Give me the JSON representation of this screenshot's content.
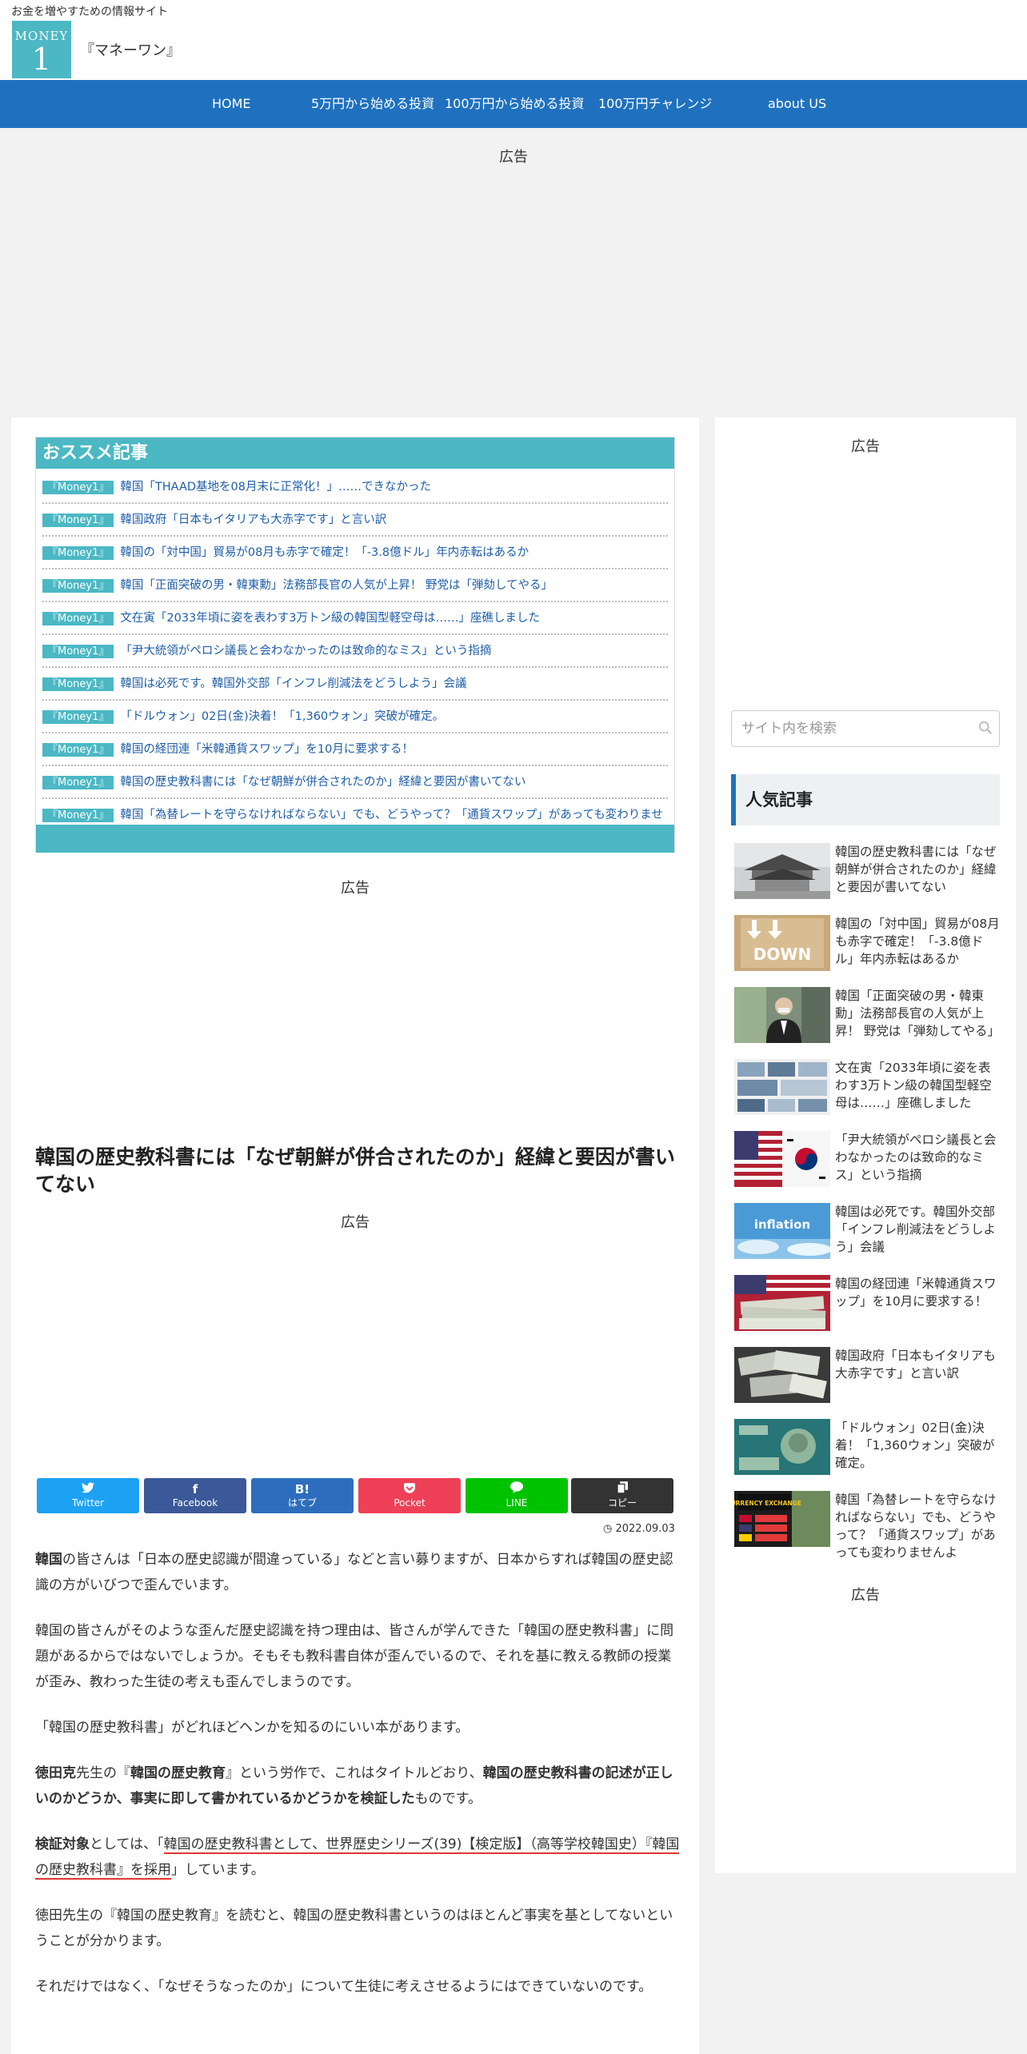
{
  "header": {
    "tagline": "お金を増やすための情報サイト",
    "logo_top": "MONEY",
    "logo_num": "1",
    "site_name": "『マネーワン』"
  },
  "nav": {
    "items": [
      "HOME",
      "5万円から始める投資",
      "100万円から始める投資",
      "100万円チャレンジ",
      "about US"
    ]
  },
  "ads": {
    "label": "広告"
  },
  "recommend": {
    "title": "おススメ記事",
    "tag": "『Money1』",
    "items": [
      "韓国「THAAD基地を08月末に正常化！」……できなかった",
      "韓国政府「日本もイタリアも大赤字です」と言い訳",
      "韓国の「対中国」貿易が08月も赤字で確定！「-3.8億ドル」年内赤転はあるか",
      "韓国「正面突破の男・韓東勳」法務部長官の人気が上昇！ 野党は「弾劾してやる」",
      "文在寅「2033年頃に姿を表わす3万トン級の韓国型軽空母は……」座礁しました",
      "「尹大統領がペロシ議長と会わなかったのは致命的なミス」という指摘",
      "韓国は必死です。韓国外交部「インフレ削減法をどうしよう」会議",
      "「ドルウォン」02日(金)決着！「1,360ウォン」突破が確定。",
      "韓国の経団連「米韓通貨スワップ」を10月に要求する！",
      "韓国の歴史教科書には「なぜ朝鮮が併合されたのか」経緯と要因が書いてない",
      "韓国「為替レートを守らなければならない」でも、どうやって？「通貨スワップ」があっても変わりませんよ"
    ]
  },
  "article": {
    "title": "韓国の歴史教科書には「なぜ朝鮮が併合されたのか」経緯と要因が書いてない",
    "date": "2022.09.03",
    "p1_bold": "韓国",
    "p1_rest": "の皆さんは「日本の歴史認識が間違っている」などと言い募りますが、日本からすれば韓国の歴史認識の方がいびつで歪んでいます。",
    "p2": "韓国の皆さんがそのような歪んだ歴史認識を持つ理由は、皆さんが学んできた「韓国の歴史教科書」に問題があるからではないでしょうか。そもそも教科書自体が歪んでいるので、それを基に教える教師の授業が歪み、教わった生徒の考えも歪んでしまうのです。",
    "p3": "「韓国の歴史教科書」がどれほどヘンかを知るのにいい本があります。",
    "p4_a": "徳田克",
    "p4_b": "先生の『",
    "p4_c": "韓国の歴史教育",
    "p4_d": "』という労作で、これはタイトルどおり、",
    "p4_e": "韓国の歴史教科書の記述が正しいのかどうか、事実に即して書かれているかどうかを検証した",
    "p4_f": "ものです。",
    "p5_a": "検証対象",
    "p5_b": "としては、「",
    "p5_link": "韓国の歴史教科書として、世界歴史シリーズ(39)【検定版】（高等学校韓国史）『韓国の歴史教科書』を採用",
    "p5_c": "」しています。",
    "p6": "徳田先生の『韓国の歴史教育』を読むと、韓国の歴史教科書というのはほとんど事実を基としてないということが分かります。",
    "p7": "それだけではなく、「なぜそうなったのか」について生徒に考えさせるようにはできていないのです。"
  },
  "share": {
    "buttons": [
      {
        "icon": "🐦",
        "label": "Twitter",
        "color": "#1da1f2"
      },
      {
        "icon": "f",
        "label": "Facebook",
        "color": "#3b5998"
      },
      {
        "icon": "B!",
        "label": "はてブ",
        "color": "#2c6ebd"
      },
      {
        "icon": "◉",
        "label": "Pocket",
        "color": "#ee4056"
      },
      {
        "icon": "●",
        "label": "LINE",
        "color": "#00c300"
      },
      {
        "icon": "⧉",
        "label": "コピー",
        "color": "#333333"
      }
    ]
  },
  "sidebar": {
    "search_placeholder": "サイト内を検索",
    "popular_title": "人気記事",
    "popular": [
      "韓国の歴史教科書には「なぜ朝鮮が併合されたのか」経緯と要因が書いてない",
      "韓国の「対中国」貿易が08月も赤字で確定！「-3.8億ドル」年内赤転はあるか",
      "韓国「正面突破の男・韓東勳」法務部長官の人気が上昇！ 野党は「弾劾してやる」",
      "文在寅「2033年頃に姿を表わす3万トン級の韓国型軽空母は……」座礁しました",
      "「尹大統領がペロシ議長と会わなかったのは致命的なミス」という指摘",
      "韓国は必死です。韓国外交部「インフレ削減法をどうしよう」会議",
      "韓国の経団連「米韓通貨スワップ」を10月に要求する！",
      "韓国政府「日本もイタリアも大赤字です」と言い訳",
      "「ドルウォン」02日(金)決着！「1,360ウォン」突破が確定。",
      "韓国「為替レートを守らなければならない」でも、どうやって？「通貨スワップ」があっても変わりませんよ"
    ],
    "thumb_text_down": "DOWN",
    "thumb_text_inflation": "inflation",
    "thumb_text_currency": "CURRENCY EXCHANGE"
  }
}
